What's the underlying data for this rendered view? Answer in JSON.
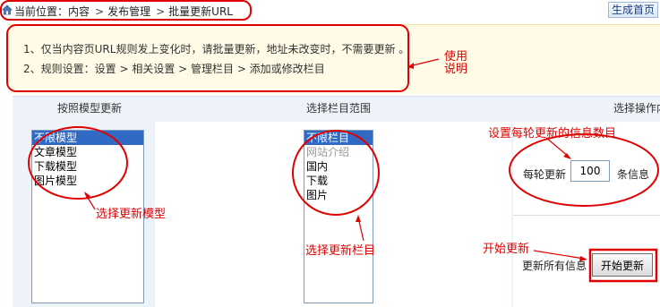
{
  "breadcrumb": {
    "prefix": "当前位置：",
    "items": [
      "内容",
      "发布管理",
      "批量更新URL"
    ],
    "separator": ">"
  },
  "top_right_button": "生成首页",
  "instructions": {
    "line1": "1、仅当内容页URL规则发上变化时，请批量更新，地址未改变时，不需要更新 。",
    "line2": "2、规则设置：设置 > 相关设置 > 管理栏目 > 添加或修改栏目"
  },
  "columns": {
    "model_header": "按照模型更新",
    "category_header": "选择栏目范围",
    "action_header": "选择操作内"
  },
  "model_list": [
    "不限模型",
    "文章模型",
    "下载模型",
    "图片模型"
  ],
  "model_selected": "不限模型",
  "category_list": [
    "不限栏目",
    "网站介绍",
    "国内",
    "下载",
    "图片"
  ],
  "category_selected": "不限栏目",
  "category_disabled": [
    "网站介绍"
  ],
  "per_round": {
    "label": "每轮更新",
    "value": "100",
    "unit": "条信息"
  },
  "update_all": {
    "label": "更新所有信息",
    "button": "开始更新"
  },
  "annotations": {
    "usage": "使用\n说明",
    "select_model": "选择更新模型",
    "select_category": "选择更新栏目",
    "set_count": "设置每轮更新的信息数目",
    "start_update": "开始更新"
  },
  "annotation_color": "#e00000",
  "selection_color": "#316ac5"
}
